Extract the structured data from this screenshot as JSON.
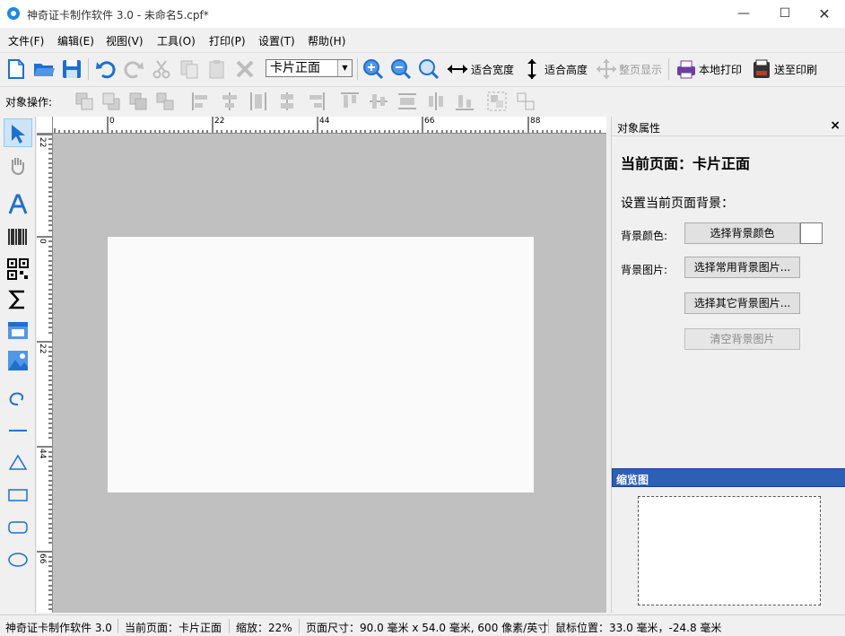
{
  "window": {
    "title": "神奇证卡制作软件 3.0 - 未命名5.cpf*",
    "min_label": "—",
    "max_label": "☐",
    "close_label": "✕"
  },
  "menu": [
    "文件(F)",
    "编辑(E)",
    "视图(V)",
    "工具(O)",
    "打印(P)",
    "设置(T)",
    "帮助(H)"
  ],
  "toolbar": {
    "page_select": "卡片正面",
    "fit_width": "适合宽度",
    "fit_height": "适合高度",
    "whole_page": "整页显示",
    "local_print": "本地打印",
    "send_print": "送至印刷"
  },
  "ops_bar": {
    "label": "对象操作:"
  },
  "rulers": {
    "h_labels": [
      "0",
      "22",
      "44",
      "66",
      "88"
    ],
    "v_labels": [
      "22",
      "0",
      "22",
      "44",
      "66"
    ]
  },
  "properties": {
    "title": "对象属性",
    "close": "×",
    "current_page": "当前页面：卡片正面",
    "set_background": "设置当前页面背景：",
    "bg_color_label": "背景颜色:",
    "bg_color_button": "选择背景颜色",
    "bg_color_value": "#ffffff",
    "bg_image_label": "背景图片:",
    "common_bg_button": "选择常用背景图片...",
    "other_bg_button": "选择其它背景图片...",
    "clear_bg_button": "清空背景图片"
  },
  "thumbnail": {
    "title": "缩览图"
  },
  "status": {
    "app": "神奇证卡制作软件 3.0",
    "current_page": "当前页面：卡片正面",
    "zoom": "缩放：22%",
    "page_size": "页面尺寸：90.0 毫米 x 54.0 毫米, 600 像素/英寸",
    "mouse_pos": "鼠标位置：33.0 毫米，-24.8 毫米"
  },
  "colors": {
    "accent": "#2c5fb6",
    "canvas_bg": "#c0c0c0",
    "icon_blue": "#1e6fd0"
  }
}
